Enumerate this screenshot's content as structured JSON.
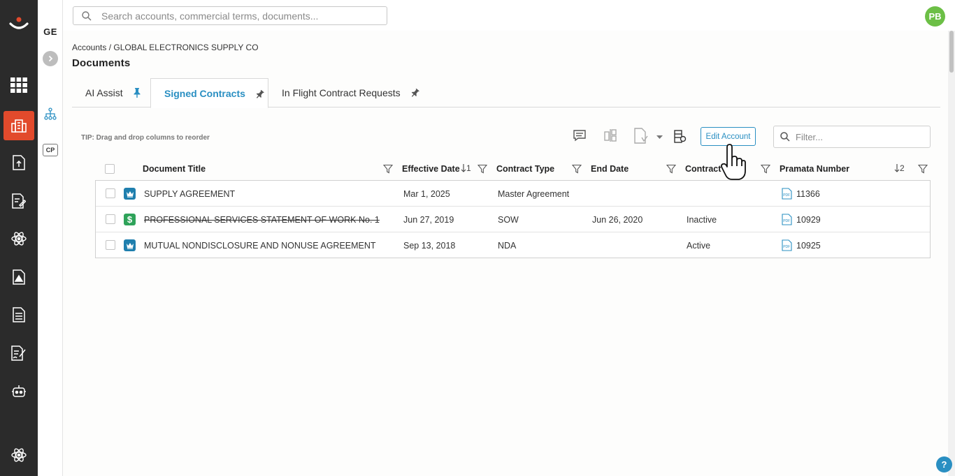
{
  "leftnav": {
    "logo_icon": "brand-logo-icon",
    "items": [
      {
        "name": "apps-grid-icon",
        "active": false
      },
      {
        "name": "accounts-building-icon",
        "active": true
      },
      {
        "name": "document-upload-icon",
        "active": false
      },
      {
        "name": "document-edit-icon",
        "active": false
      },
      {
        "name": "atom-icon",
        "active": false
      },
      {
        "name": "document-image-icon",
        "active": false
      },
      {
        "name": "document-list-icon",
        "active": false
      },
      {
        "name": "document-sign-icon",
        "active": false
      },
      {
        "name": "robot-icon",
        "active": false
      },
      {
        "name": "settings-atom-icon",
        "active": false
      }
    ],
    "active_color": "#e24a2c"
  },
  "subnav": {
    "account_initials": "GE",
    "collapse_icon": "chevron-right-icon",
    "hierarchy_icon": "hierarchy-icon",
    "cp_label": "CP"
  },
  "topbar": {
    "search_placeholder": "Search accounts, commercial terms, documents...",
    "avatar_initials": "PB",
    "avatar_color": "#6cbf46"
  },
  "breadcrumb": "Accounts / GLOBAL ELECTRONICS SUPPLY CO",
  "page_title": "Documents",
  "tabs": [
    {
      "label": "AI Assist",
      "active": false,
      "pinned": true
    },
    {
      "label": "Signed Contracts",
      "active": true,
      "pinned": true
    },
    {
      "label": "In Flight Contract Requests",
      "active": false,
      "pinned": true
    }
  ],
  "tip": "TIP: Drag and drop columns to reorder",
  "toolbar": {
    "edit_account_label": "Edit Account",
    "filter_placeholder": "Filter..."
  },
  "table": {
    "columns": [
      {
        "label": "Document Title",
        "sort": ""
      },
      {
        "label": "Effective Date",
        "sort": "1"
      },
      {
        "label": "Contract Type",
        "sort": ""
      },
      {
        "label": "End Date",
        "sort": ""
      },
      {
        "label": "Contract S",
        "sort": ""
      },
      {
        "label": "Pramata Number",
        "sort": "2"
      }
    ],
    "rows": [
      {
        "icon": "crown-icon",
        "title": "SUPPLY AGREEMENT",
        "struck": false,
        "effective_date": "Mar 1, 2025",
        "contract_type": "Master Agreement",
        "end_date": "",
        "status": "",
        "pramata_number": "11366"
      },
      {
        "icon": "dollar-icon",
        "title": "PROFESSIONAL SERVICES STATEMENT OF WORK No. 1",
        "struck": true,
        "effective_date": "Jun 27, 2019",
        "contract_type": "SOW",
        "end_date": "Jun 26, 2020",
        "status": "Inactive",
        "pramata_number": "10929"
      },
      {
        "icon": "crown-icon",
        "title": "MUTUAL NONDISCLOSURE AND NONUSE AGREEMENT",
        "struck": false,
        "effective_date": "Sep 13, 2018",
        "contract_type": "NDA",
        "end_date": "",
        "status": "Active",
        "pramata_number": "10925"
      }
    ]
  },
  "help_label": "?",
  "accent_color": "#2a8fc2"
}
